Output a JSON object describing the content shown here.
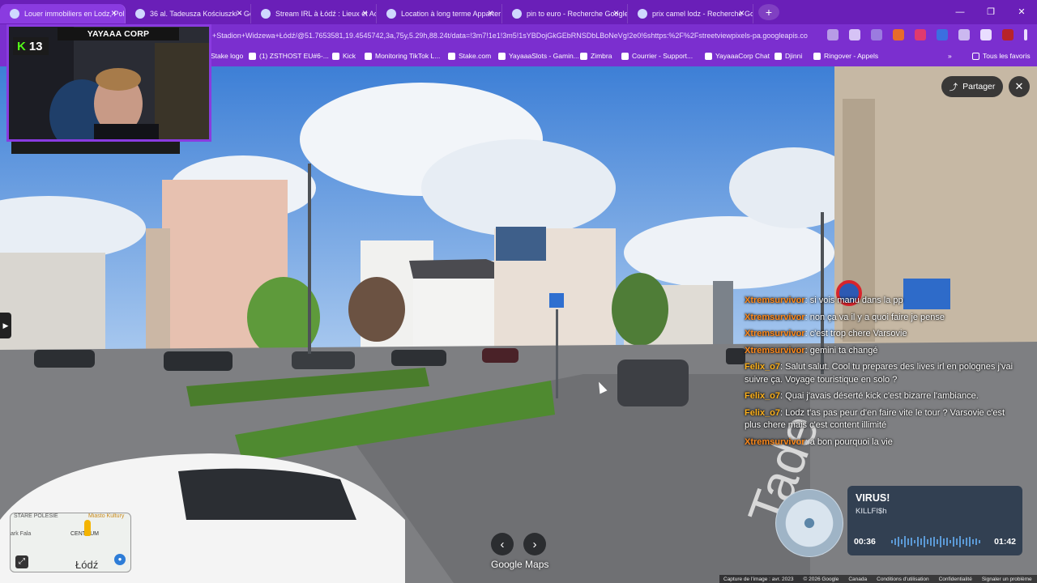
{
  "browser": {
    "tabs": [
      {
        "label": "Louer immobiliers en Lodz, Pol",
        "active": true
      },
      {
        "label": "36 al. Tadeusza Kościuszki - Go",
        "active": false
      },
      {
        "label": "Stream IRL à Łódź : Lieux et Act",
        "active": false
      },
      {
        "label": "Location à long terme Apparter",
        "active": false
      },
      {
        "label": "pin to euro - Recherche Google",
        "active": false
      },
      {
        "label": "prix camel lodz - Recherche Go",
        "active": false
      }
    ],
    "new_tab": "+",
    "url": "+Stadion+Widzewa+Łódź/@51.7653581,19.4545742,3a,75y,5.29h,88.24t/data=!3m7!1e1!3m5!1sYBDojGkGEbRNSDbLBoNeVg!2e0!6shttps:%2F%2Fstreetviewpixels-pa.googleapis.co",
    "bookmarks": [
      {
        "label": "Stake logo"
      },
      {
        "label": "(1) ZSTHOST EU#6-..."
      },
      {
        "label": "Kick"
      },
      {
        "label": "Monitoring TikTok L..."
      },
      {
        "label": "Stake.com"
      },
      {
        "label": "YayaaaSlots - Gamin..."
      },
      {
        "label": "Zimbra"
      },
      {
        "label": "Courrier - Support..."
      },
      {
        "label": "YayaaaCorp Chat"
      },
      {
        "label": "Djinni"
      },
      {
        "label": "Ringover - Appels"
      }
    ],
    "all_favorites": "Tous les favoris"
  },
  "streetview": {
    "share_label": "Partager",
    "close_label": "✕",
    "brand": "Google Maps",
    "footer": [
      "Capture de l'image : avr. 2023",
      "© 2026 Google",
      "Canada",
      "Conditions d'utilisation",
      "Confidentialité",
      "Signaler un problème"
    ],
    "minimap": {
      "labels": [
        "STARE POLESIE",
        "Miasto Kultury",
        "ark Fala",
        "CENTRUM"
      ],
      "city": "Łódź"
    }
  },
  "stream": {
    "cam_title": "YAYAAA CORP",
    "kick_count": "13"
  },
  "chat": [
    {
      "user": "Xtremsurvivor",
      "text": ": si vois manu dans la pp",
      "color": "#ff8a1c"
    },
    {
      "user": "Xtremsurvivor",
      "text": ": non ça va il y a quoi faire je pense",
      "color": "#ff8a1c"
    },
    {
      "user": "Xtremsurvivor",
      "text": ": c'est trop chere Varsovie",
      "color": "#ff8a1c"
    },
    {
      "user": "Xtremsurvivor",
      "text": ": gemini ta changé",
      "color": "#ff8a1c"
    },
    {
      "user": "Felix_o7",
      "text": ": Salut salut. Cool tu prepares des lives irl en polognes j'vai suivre ça. Voyage touristique en solo ?",
      "color": "#ffb21c"
    },
    {
      "user": "Felix_o7",
      "text": ": Quai j'avais déserté kick c'est bizarre l'ambiance.",
      "color": "#ffb21c"
    },
    {
      "user": "Felix_o7",
      "text": ": Lodz t'as pas peur d'en faire vite le tour ? Varsovie c'est plus chere mais c'est content illimité",
      "color": "#ffb21c"
    },
    {
      "user": "Xtremsurvivor",
      "text": ": a bon pourquoi la vie",
      "color": "#ff8a1c"
    }
  ],
  "music": {
    "title": "VIRUS!",
    "artist": "KILLFI$h",
    "elapsed": "00:36",
    "duration": "01:42"
  }
}
